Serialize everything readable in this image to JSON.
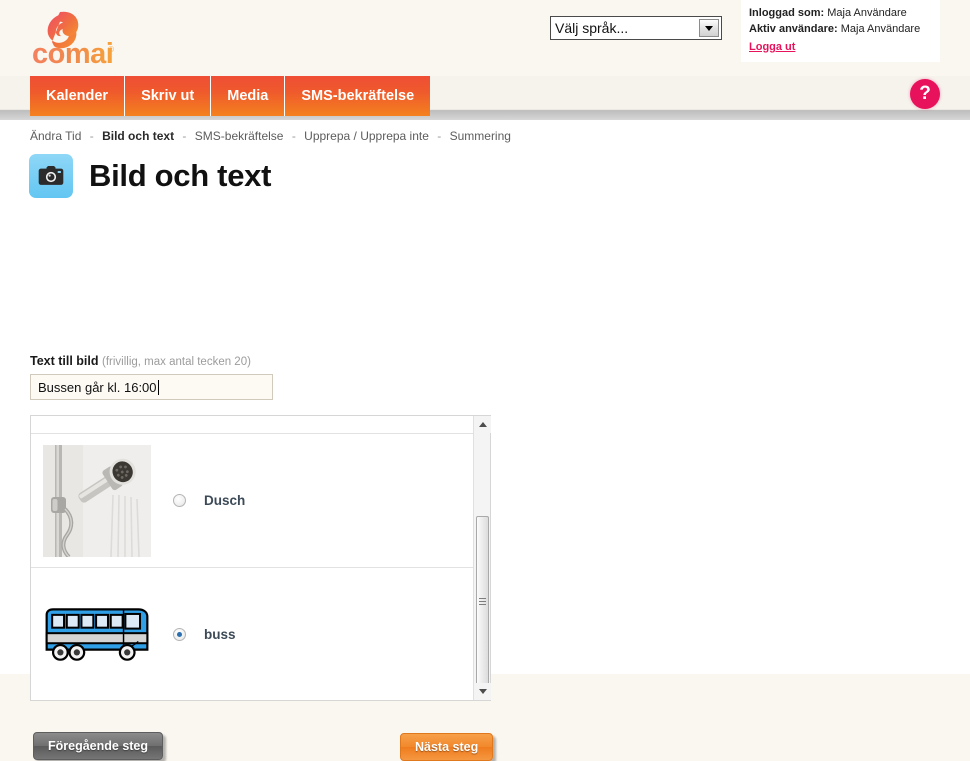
{
  "brand": {
    "logo_text": "comai",
    "logo_mark": "comma-swirl-icon",
    "accent_orange": "#f4811f",
    "accent_red": "#ef4e35",
    "accent_pink": "#e8115b"
  },
  "header": {
    "language_select": {
      "value": "Välj språk...",
      "icon": "chevron-down-icon"
    },
    "user_box": {
      "logged_in_label": "Inloggad som:",
      "logged_in_value": "Maja Användare",
      "active_user_label": "Aktiv användare:",
      "active_user_value": "Maja Användare",
      "logout_label": "Logga ut"
    },
    "help_label": "?"
  },
  "nav": {
    "tabs": [
      {
        "label": "Kalender"
      },
      {
        "label": "Skriv ut"
      },
      {
        "label": "Media"
      },
      {
        "label": "SMS-bekräftelse"
      }
    ]
  },
  "breadcrumb": {
    "separator": "-",
    "steps": [
      {
        "label": "Ändra Tid",
        "current": false
      },
      {
        "label": "Bild och text",
        "current": true
      },
      {
        "label": "SMS-bekräftelse",
        "current": false
      },
      {
        "label": "Upprepa / Upprepa inte",
        "current": false
      },
      {
        "label": "Summering",
        "current": false
      }
    ]
  },
  "page": {
    "title": "Bild och text",
    "icon": "camera-icon"
  },
  "form": {
    "text_field": {
      "label": "Text till bild",
      "hint": "(frivillig, max antal tecken 20)",
      "value": "Bussen går kl. 16:00",
      "placeholder": "",
      "max_length": 20,
      "focused": true
    }
  },
  "picture_list": {
    "items": [
      {
        "label": "Dusch",
        "image": "shower-head-photo",
        "selected": false
      },
      {
        "label": "buss",
        "image": "blue-bus-clipart",
        "selected": true
      }
    ],
    "scrollbar": {
      "up_icon": "arrow-up-icon",
      "down_icon": "arrow-down-icon",
      "grip_icon": "scrollbar-grip-icon"
    }
  },
  "footer": {
    "prev_label": "Föregående steg",
    "next_label": "Nästa steg"
  }
}
